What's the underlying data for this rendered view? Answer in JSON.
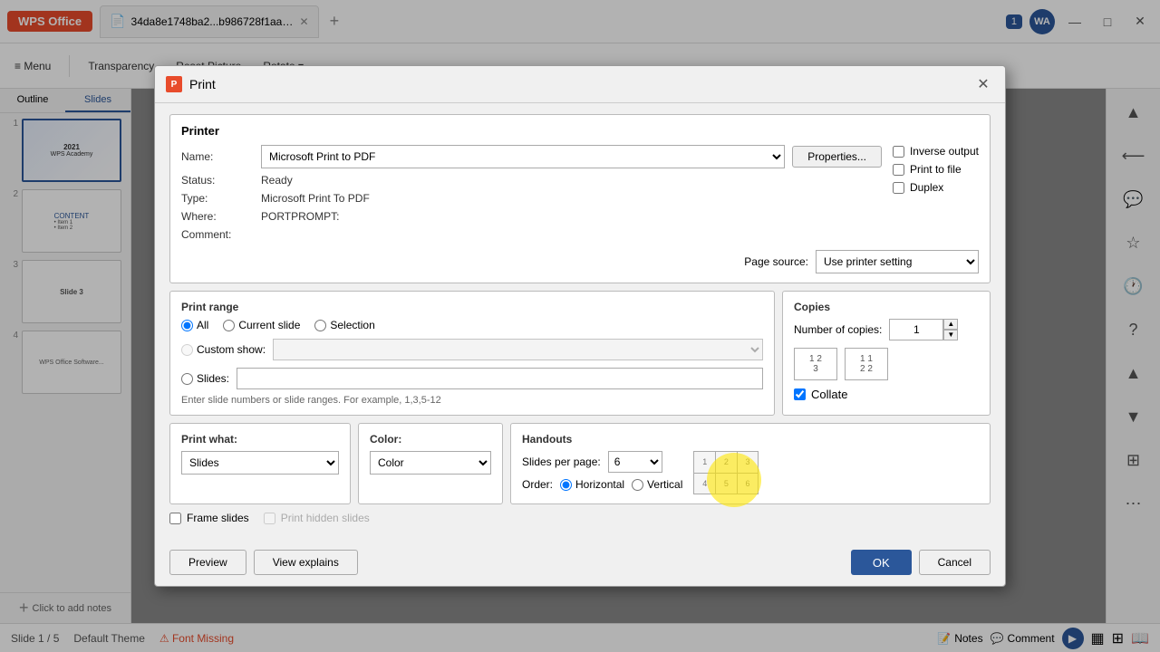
{
  "titlebar": {
    "wps_label": "WPS Office",
    "tab_label": "34da8e1748ba2...b986728f1aa9d",
    "add_tab_label": "+",
    "badge": "1",
    "user_initials": "WA",
    "minimize": "—",
    "maximize": "□",
    "close": "✕"
  },
  "toolbar": {
    "menu_label": "≡ Menu",
    "transparency_label": "Transparency",
    "reset_picture_label": "Reset Picture",
    "rotate_label": "Rotate ▾"
  },
  "sidebar": {
    "tab_outline": "Outline",
    "tab_slides": "Slides",
    "slides": [
      {
        "num": "1",
        "active": true
      },
      {
        "num": "2"
      },
      {
        "num": "3"
      },
      {
        "num": "4"
      }
    ]
  },
  "statusbar": {
    "slide_info": "Slide 1 / 5",
    "theme": "Default Theme",
    "font_missing": "⚠ Font Missing",
    "notes_label": "Notes",
    "comment_label": "Comment",
    "play_icon": "▶"
  },
  "dialog": {
    "title": "Print",
    "title_icon": "P",
    "sections": {
      "printer": {
        "header": "Printer",
        "name_label": "Name:",
        "name_value": "Microsoft Print to PDF",
        "properties_btn": "Properties...",
        "status_label": "Status:",
        "status_value": "Ready",
        "type_label": "Type:",
        "type_value": "Microsoft Print To PDF",
        "where_label": "Where:",
        "where_value": "PORTPROMPT:",
        "comment_label": "Comment:",
        "comment_value": "",
        "inverse_output_label": "Inverse output",
        "print_to_file_label": "Print to file",
        "duplex_label": "Duplex",
        "page_source_label": "Page source:",
        "page_source_value": "Use printer setting"
      },
      "print_range": {
        "header": "Print range",
        "all_label": "All",
        "current_slide_label": "Current slide",
        "selection_label": "Selection",
        "custom_show_label": "Custom show:",
        "slides_label": "Slides:",
        "hint_text": "Enter slide numbers or slide ranges. For example, 1,3,5-12"
      },
      "copies": {
        "header": "Copies",
        "number_label": "Number of copies:",
        "number_value": "1",
        "collate_label": "Collate"
      },
      "print_what": {
        "header": "Print what:",
        "value": "Slides"
      },
      "color": {
        "header": "Color:",
        "value": "Color"
      },
      "handouts": {
        "header": "Handouts",
        "slides_per_page_label": "Slides per page:",
        "slides_per_page_value": "6",
        "order_label": "Order:",
        "horizontal_label": "Horizontal",
        "vertical_label": "Vertical",
        "grid_numbers": [
          "1",
          "2",
          "3",
          "4",
          "5",
          "6"
        ]
      },
      "frame_slides": {
        "label": "Frame slides",
        "print_hidden_label": "Print hidden slides"
      }
    },
    "footer": {
      "preview_label": "Preview",
      "view_explains_label": "View explains",
      "ok_label": "OK",
      "cancel_label": "Cancel"
    }
  }
}
